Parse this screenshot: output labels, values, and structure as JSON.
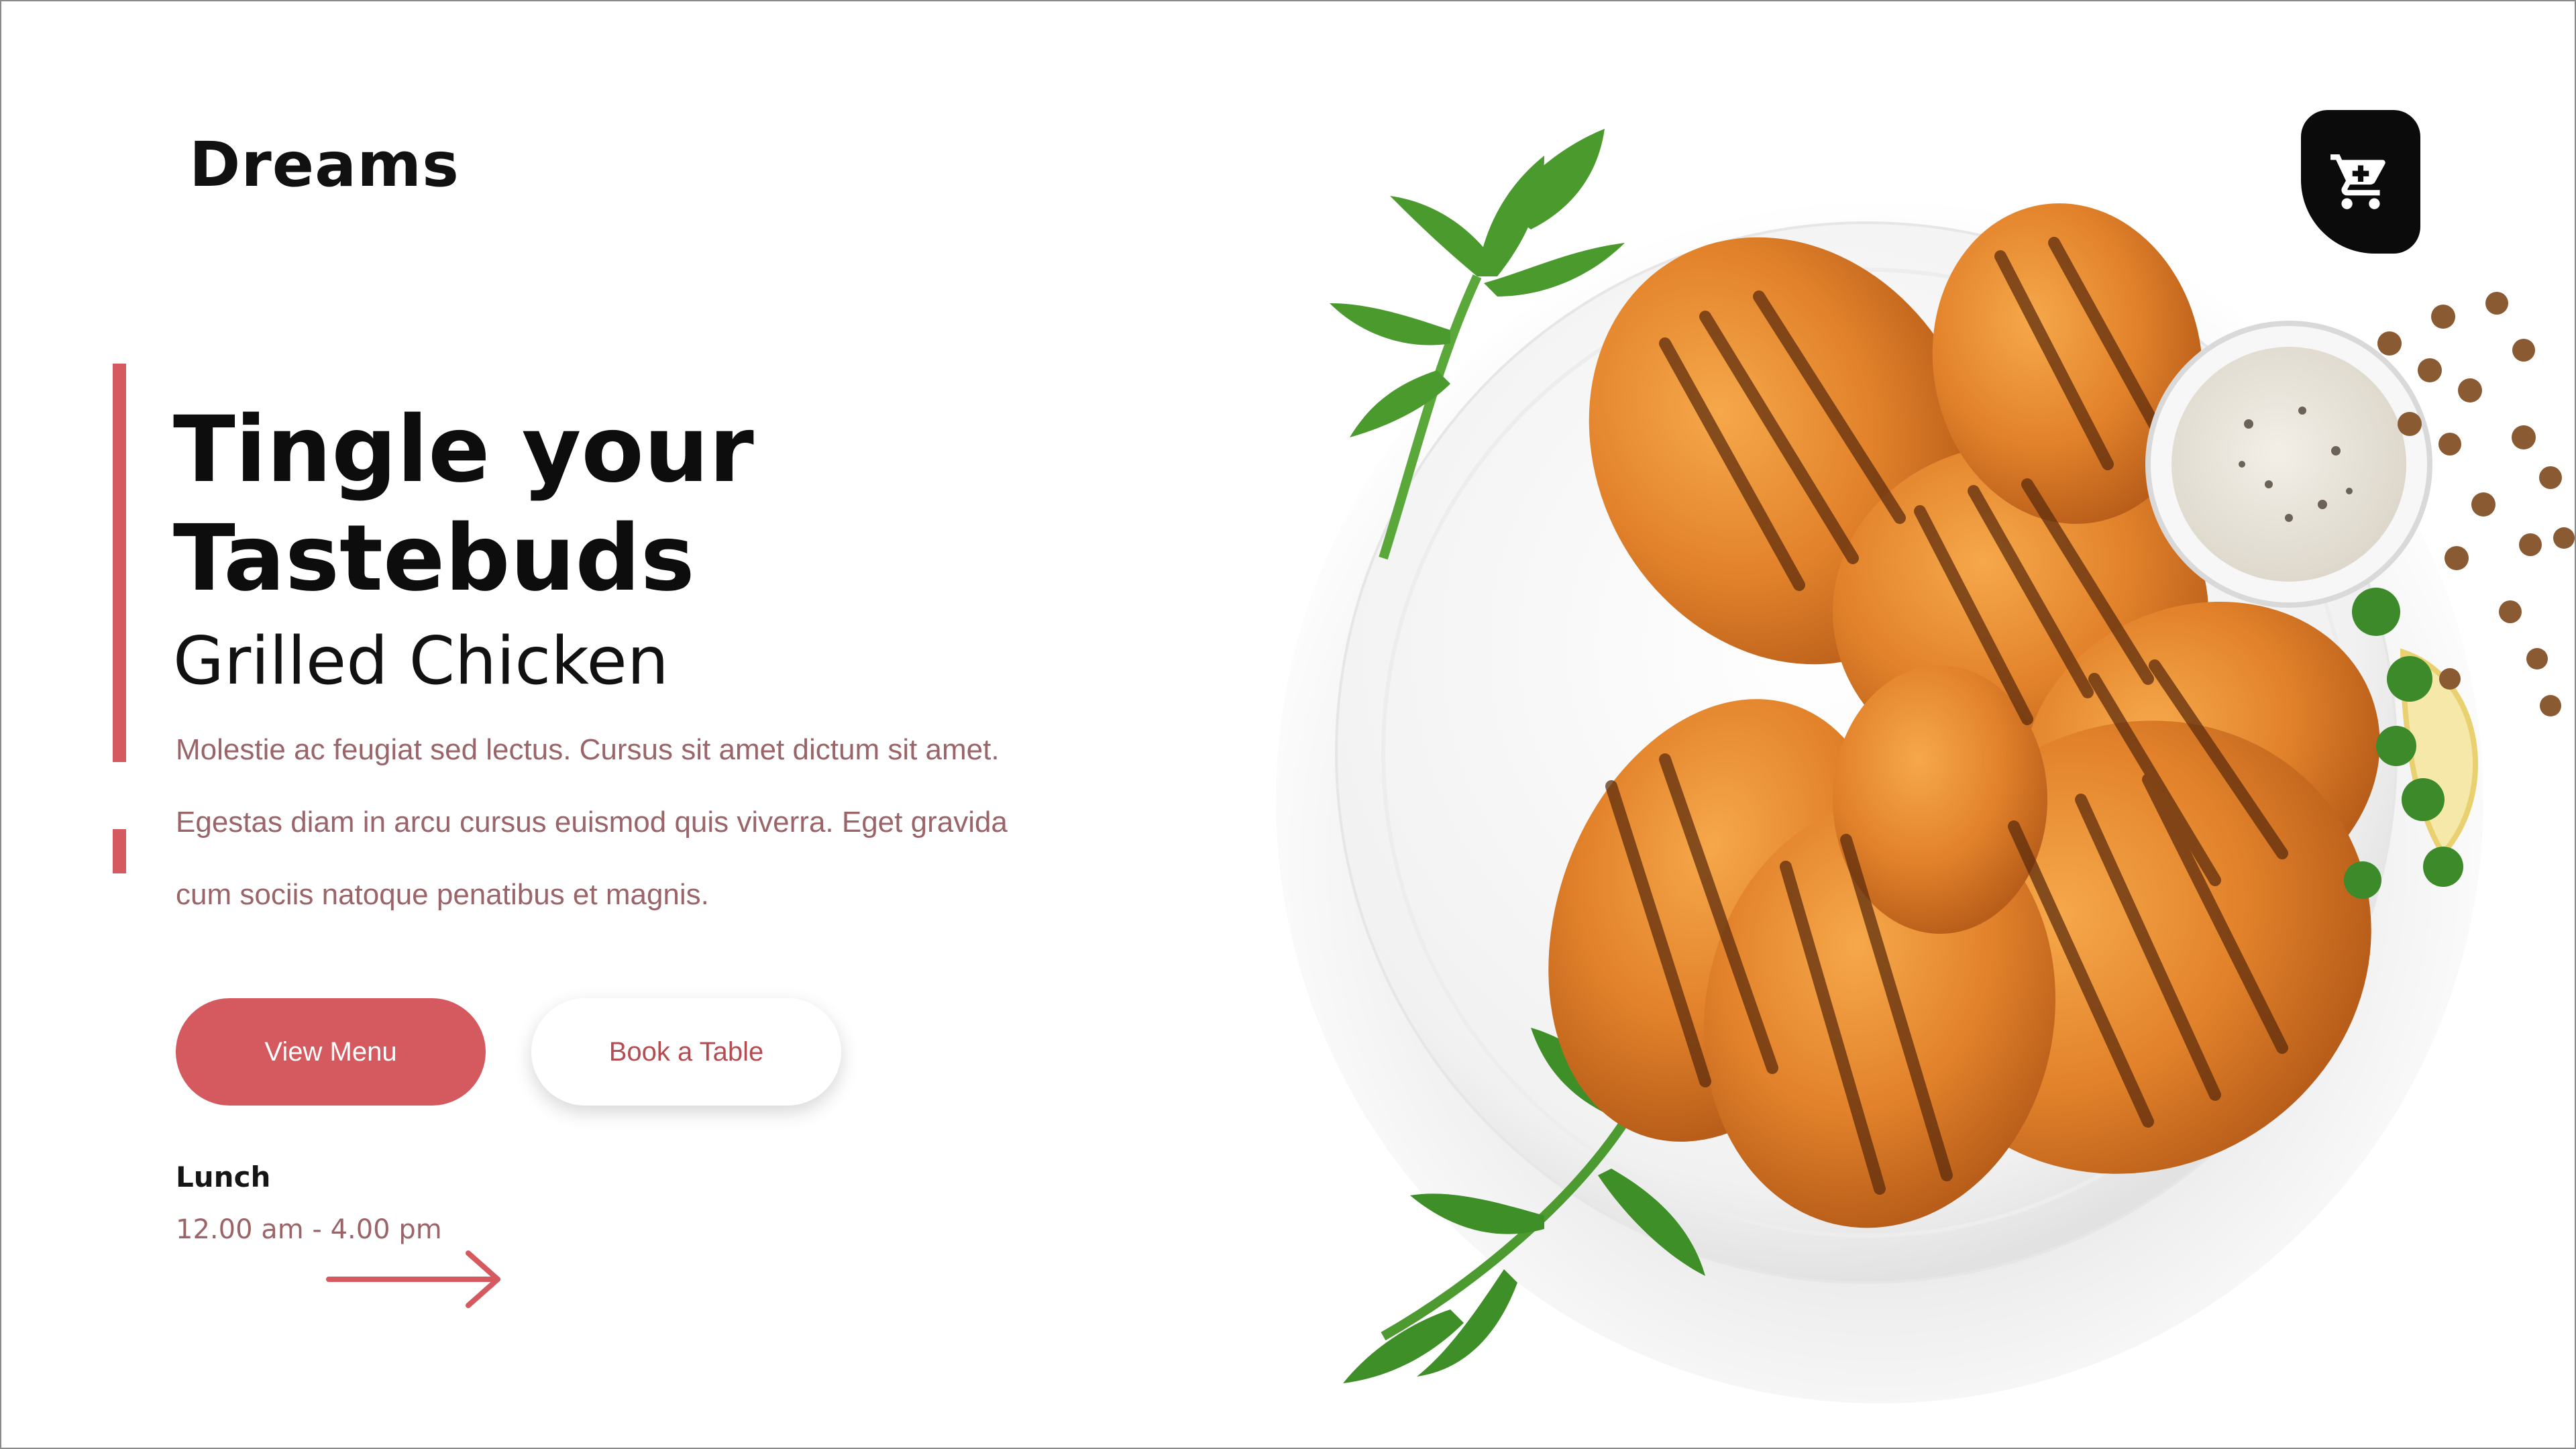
{
  "brand": {
    "logo": "Dreams"
  },
  "hero": {
    "headline_line1": "Tingle your",
    "headline_line2": "Tastebuds",
    "subheadline": "Grilled Chicken",
    "description": [
      "Molestie ac feugiat sed lectus. Cursus sit amet dictum sit amet.",
      "Egestas diam in arcu cursus euismod quis viverra. Eget gravida",
      "cum sociis natoque penatibus et magnis."
    ]
  },
  "actions": {
    "view_menu": "View Menu",
    "book_table": "Book a Table"
  },
  "hours": {
    "label": "Lunch",
    "value": "12.00 am - 4.00 pm"
  },
  "icons": {
    "cart": "cart-icon",
    "arrow": "arrow-right-icon"
  },
  "colors": {
    "accent": "#d45a5f",
    "text_muted": "#9a6468",
    "dark": "#0b0b0b"
  }
}
